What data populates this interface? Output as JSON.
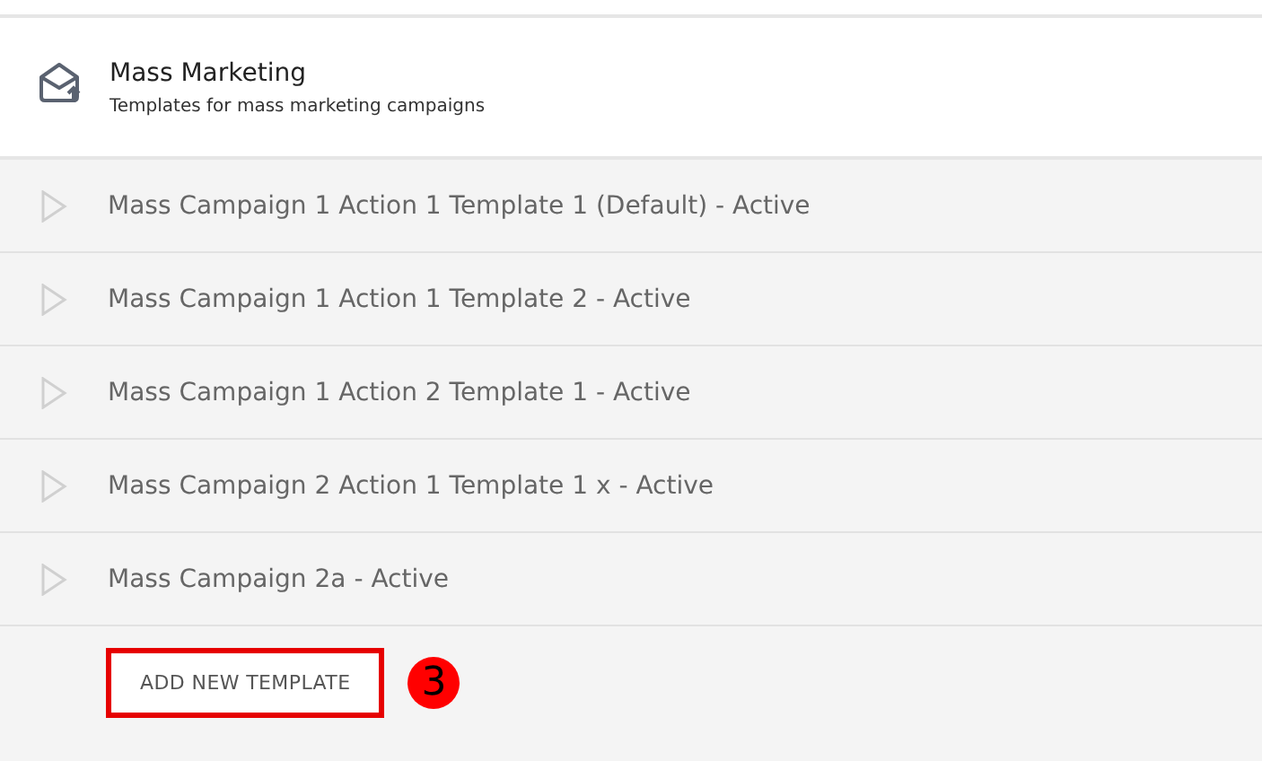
{
  "section": {
    "title": "Mass Marketing",
    "subtitle": "Templates for mass marketing campaigns"
  },
  "templates": [
    {
      "name": "Mass Campaign 1 Action 1 Template 1 (Default) - Active",
      "expanded": false
    },
    {
      "name": "Mass Campaign 1 Action 1 Template 2 - Active",
      "expanded": false
    },
    {
      "name": "Mass Campaign 1 Action 2 Template 1 - Active",
      "expanded": false
    },
    {
      "name": "Mass Campaign 2 Action 1 Template 1 x - Active",
      "expanded": false
    },
    {
      "name": "Mass Campaign 2a - Active",
      "expanded": false
    }
  ],
  "add_button": {
    "label": "ADD NEW TEMPLATE",
    "highlighted": true
  },
  "step_badge": "3"
}
